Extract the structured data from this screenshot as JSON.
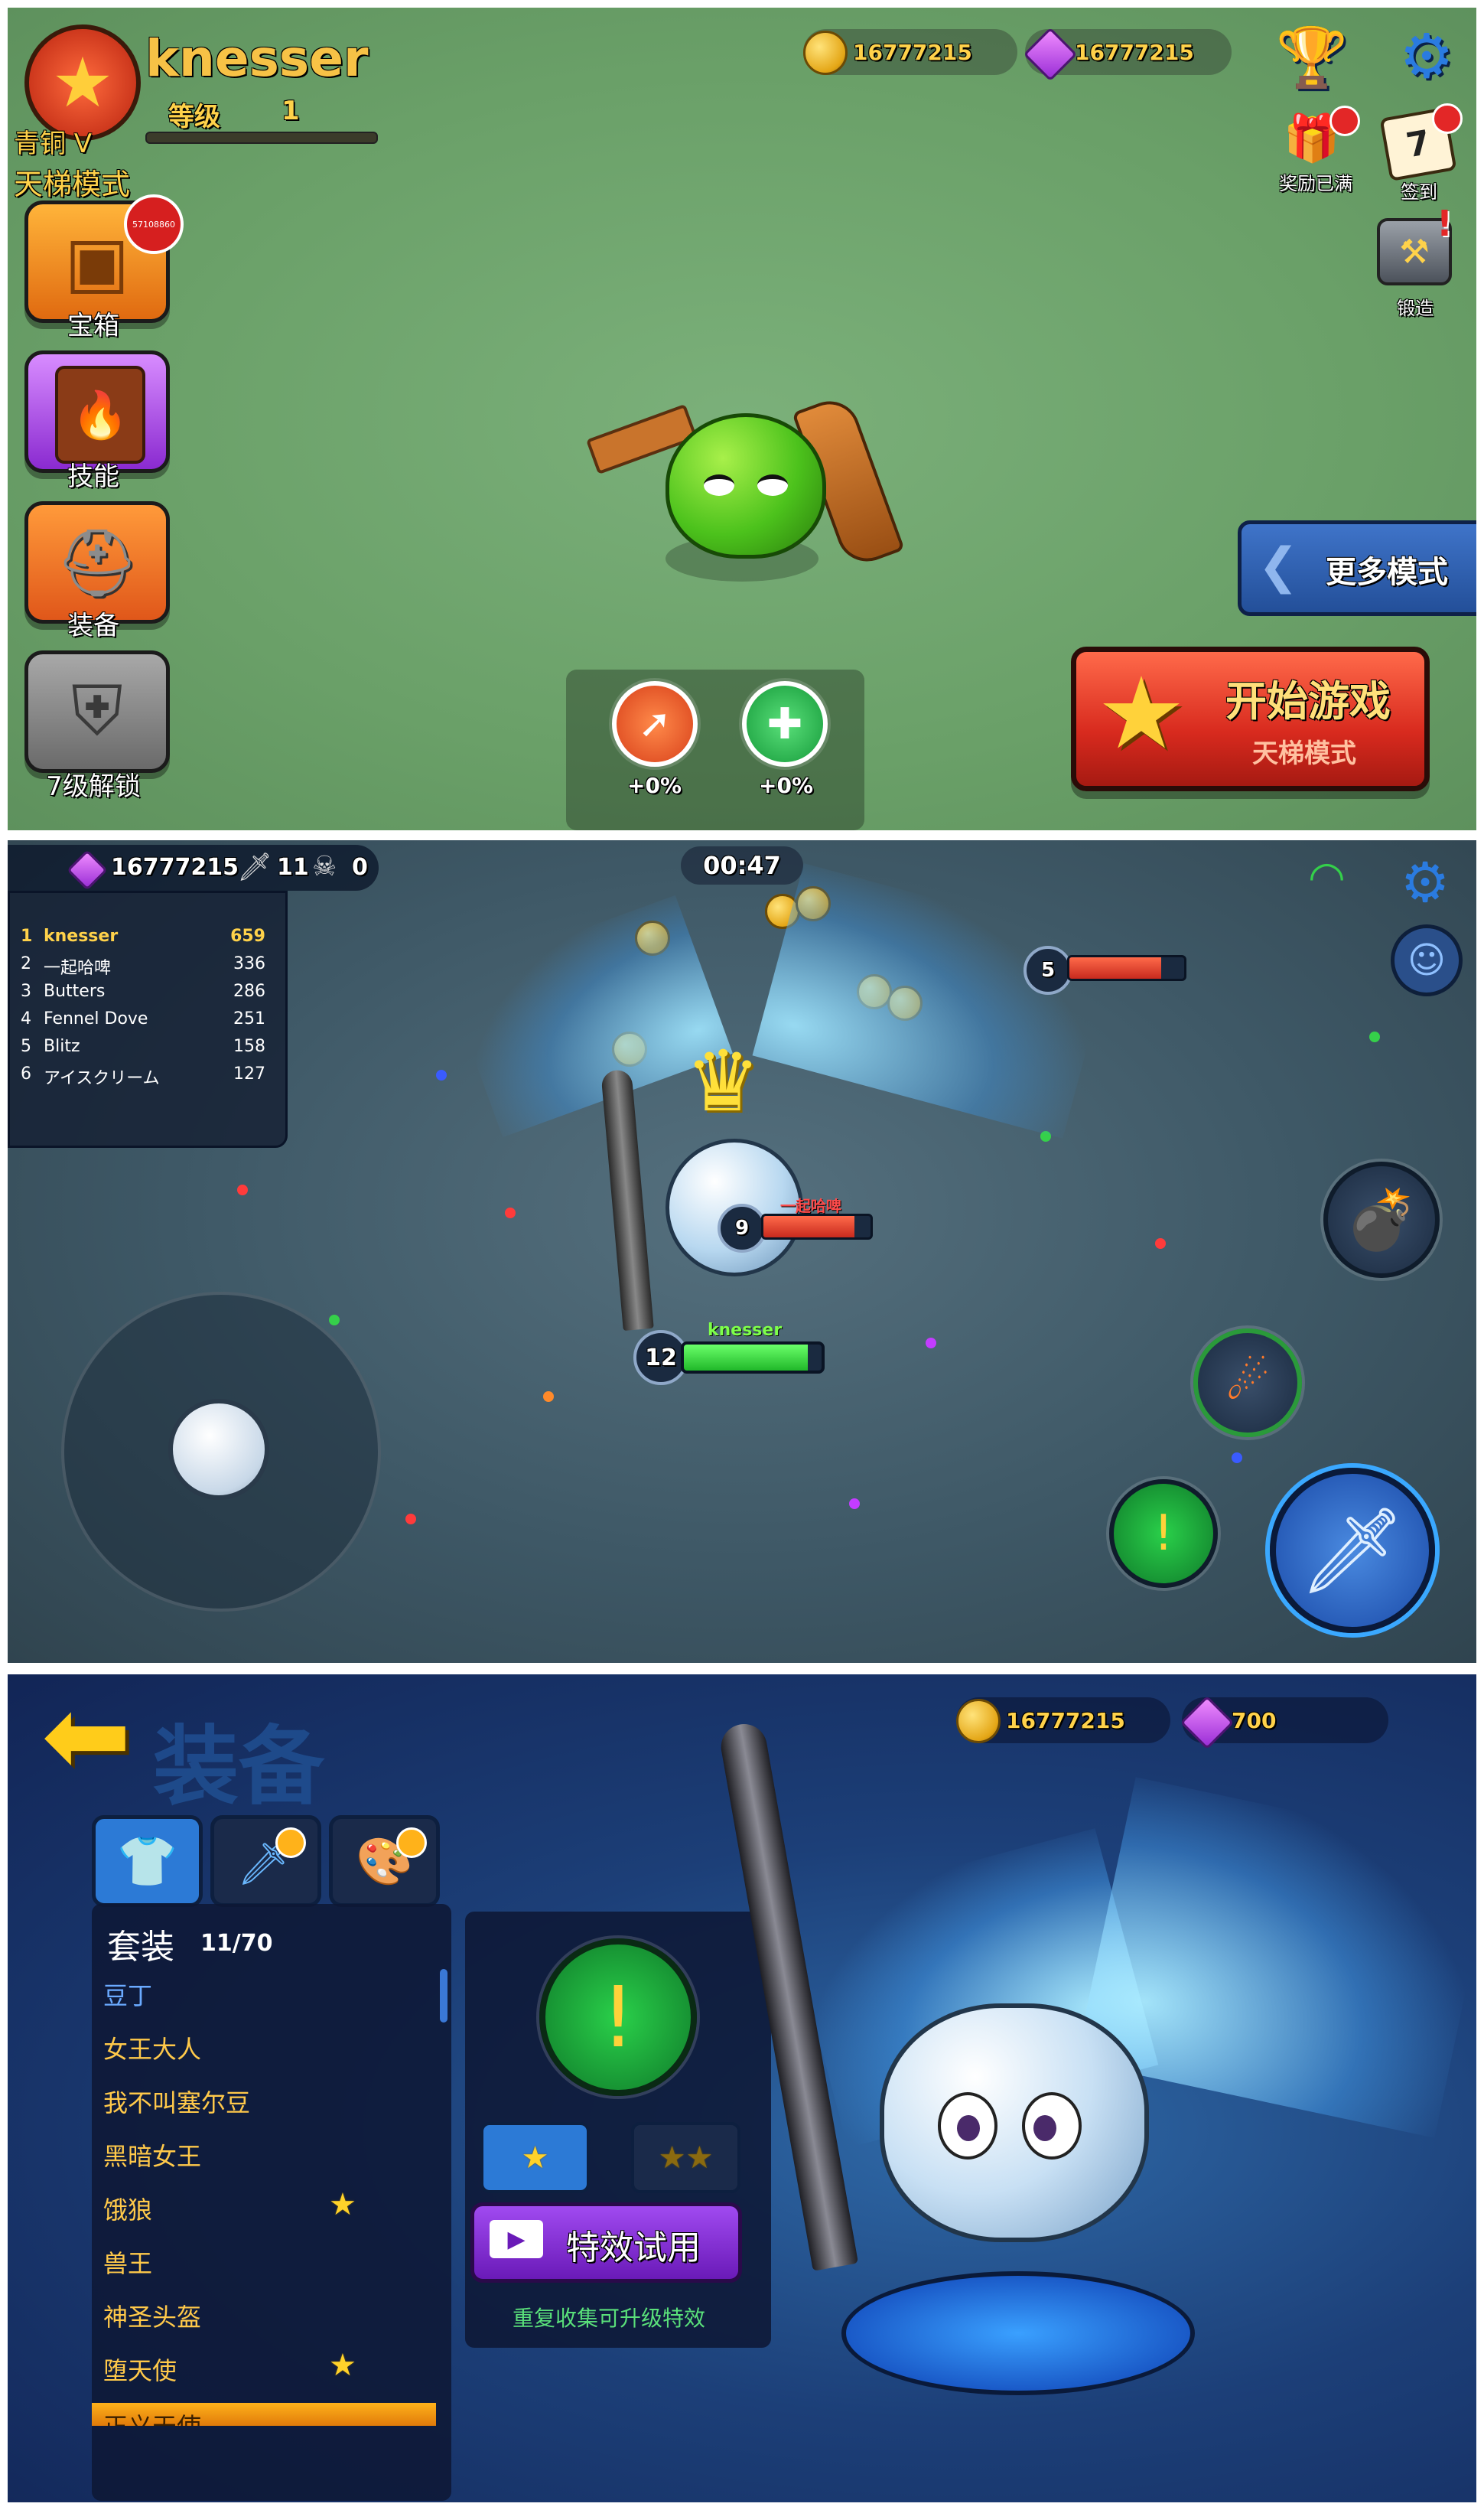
{
  "lobby": {
    "player_name": "knesser",
    "level_label": "等级",
    "level_value": "1",
    "rank": "青铜 V",
    "mode": "天梯模式",
    "coins": "16777215",
    "gems": "16777215",
    "menu": [
      {
        "label": "宝箱",
        "badge": "57108860",
        "icon": "treasure-chest-icon"
      },
      {
        "label": "技能",
        "icon": "spellbook-icon"
      },
      {
        "label": "装备",
        "icon": "viking-helmet-icon"
      },
      {
        "label": "7级解锁",
        "icon": "locked-shield-icon"
      }
    ],
    "top_right": [
      {
        "label": "",
        "icon": "trophy-icon"
      },
      {
        "label": "",
        "icon": "gear-icon"
      },
      {
        "label": "奖励已满",
        "icon": "gift-basket-icon"
      },
      {
        "label": "签到",
        "icon": "calendar-icon",
        "day": "7"
      },
      {
        "label": "锻造",
        "icon": "anvil-icon"
      }
    ],
    "more_modes": "更多模式",
    "start_title": "开始游戏",
    "start_subtitle": "天梯模式",
    "buffs": [
      {
        "value": "+0%",
        "icon": "attack-buff-icon"
      },
      {
        "value": "+0%",
        "icon": "health-buff-icon"
      }
    ],
    "colors": {
      "start_button": "#e8392c",
      "more_modes": "#2d5aa8"
    }
  },
  "battle": {
    "gems": "16777215",
    "kills": "11",
    "deaths": "0",
    "timer": "00:47",
    "leaderboard": [
      {
        "rank": "1",
        "name": "knesser",
        "score": "659"
      },
      {
        "rank": "2",
        "name": "一起哈啤",
        "score": "336"
      },
      {
        "rank": "3",
        "name": "Butters",
        "score": "286"
      },
      {
        "rank": "4",
        "name": "Fennel Dove",
        "score": "251"
      },
      {
        "rank": "5",
        "name": "Blitz",
        "score": "158"
      },
      {
        "rank": "6",
        "name": "アイスクリーム",
        "score": "127"
      }
    ],
    "player": {
      "name": "knesser",
      "level": "12",
      "hp": 0.9
    },
    "enemy1": {
      "name": "一起哈啤",
      "level": "9",
      "hp": 0.85
    },
    "enemy2": {
      "name": "",
      "level": "5",
      "hp": 0.8
    }
  },
  "equipment": {
    "title": "装备",
    "coins": "16777215",
    "gems": "700",
    "tabs": [
      {
        "icon": "shirt-icon",
        "active": true
      },
      {
        "icon": "sword-icon",
        "active": false
      },
      {
        "icon": "palette-icon",
        "active": false
      }
    ],
    "set_label": "套装",
    "set_count": "11/70",
    "items": [
      {
        "name": "豆丁",
        "star": false
      },
      {
        "name": "女王大人",
        "star": false
      },
      {
        "name": "我不叫塞尔豆",
        "star": false
      },
      {
        "name": "黑暗女王",
        "star": false
      },
      {
        "name": "饿狼",
        "star": true
      },
      {
        "name": "兽王",
        "star": false
      },
      {
        "name": "神圣头盔",
        "star": false
      },
      {
        "name": "堕天使",
        "star": true
      },
      {
        "name": "正义天使",
        "star": true
      }
    ],
    "trial_button": "特效试用",
    "hint": "重复收集可升级特效"
  }
}
